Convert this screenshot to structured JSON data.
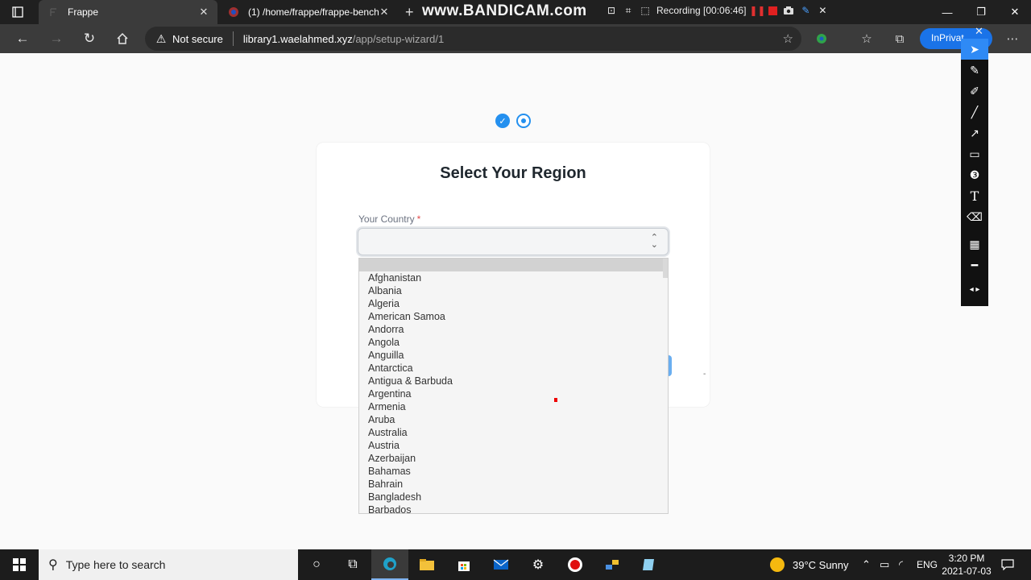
{
  "browser": {
    "tabs": [
      {
        "title": "Frappe",
        "active": true
      },
      {
        "title": "(1) /home/frappe/frappe-bench/",
        "active": false
      }
    ],
    "new_tab_glyph": "+",
    "address": {
      "security_label": "Not secure",
      "host": "library1.waelahmed.xyz",
      "path": "/app/setup-wizard/1"
    },
    "inprivate_label": "InPrivat"
  },
  "recorder": {
    "watermark": "www.BANDICAM.com",
    "status": "Recording [00:06:46]"
  },
  "wizard": {
    "title": "Select Your Region",
    "field_label": "Your Country",
    "required_mark": "*",
    "selected_value": ""
  },
  "country_options": [
    "Afghanistan",
    "Albania",
    "Algeria",
    "American Samoa",
    "Andorra",
    "Angola",
    "Anguilla",
    "Antarctica",
    "Antigua & Barbuda",
    "Argentina",
    "Armenia",
    "Aruba",
    "Australia",
    "Austria",
    "Azerbaijan",
    "Bahamas",
    "Bahrain",
    "Bangladesh",
    "Barbados"
  ],
  "taskbar": {
    "search_placeholder": "Type here to search",
    "weather": "39°C  Sunny",
    "language": "ENG",
    "time": "3:20 PM",
    "date": "2021-07-03"
  },
  "colors": {
    "accent": "#2490ef",
    "browser_chrome": "#202020",
    "recording_red": "#e02020"
  }
}
